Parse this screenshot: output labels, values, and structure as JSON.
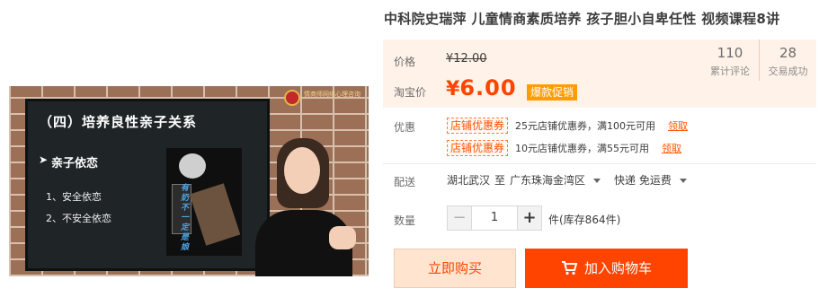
{
  "thumbnail": {
    "slide_title": "（四）培养良性亲子关系",
    "slide_heading": "亲子依恋",
    "slide_items": [
      "1、安全依恋",
      "2、不安全依恋"
    ],
    "slide_vertical_text": "有奶不一定是娘",
    "badge_text": "情商师网络心理咨询"
  },
  "product": {
    "title": "中科院史瑞萍 儿童情商素质培养 孩子胆小自卑任性 视频课程8讲"
  },
  "price": {
    "label": "价格",
    "original": "¥12.00",
    "taobao_label": "淘宝价",
    "currency": "¥",
    "current": "6.00",
    "promo_tag": "爆款促销"
  },
  "stats": [
    {
      "number": "110",
      "caption": "累计评论"
    },
    {
      "number": "28",
      "caption": "交易成功"
    }
  ],
  "promotions": {
    "label": "优惠",
    "coupons": [
      {
        "tag": "店铺优惠券",
        "desc": "25元店铺优惠券，满100元可用",
        "action": "领取"
      },
      {
        "tag": "店铺优惠券",
        "desc": "10元店铺优惠券，满55元可用",
        "action": "领取"
      }
    ]
  },
  "shipping": {
    "label": "配送",
    "from": "湖北武汉",
    "to_word": "至",
    "destination": "广东珠海金湾区",
    "method": "快递 免运费"
  },
  "quantity": {
    "label": "数量",
    "minus": "−",
    "value": "1",
    "plus": "+",
    "stock": "件(库存864件)"
  },
  "actions": {
    "buy_now": "立即购买",
    "add_to_cart": "加入购物车"
  },
  "colors": {
    "accent": "#ff4400",
    "price_box": "#fff2e8",
    "promo_tag": "#ff9d00"
  }
}
